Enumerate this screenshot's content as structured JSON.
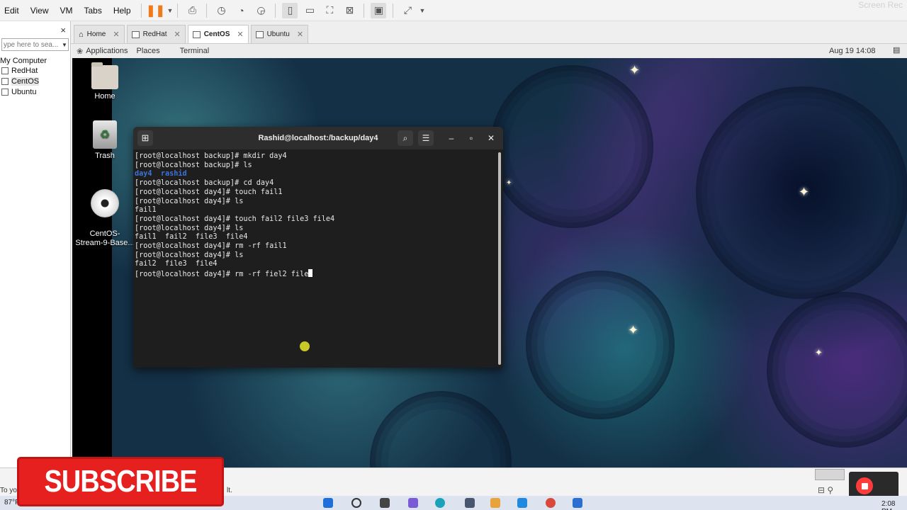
{
  "menubar": {
    "items": [
      "Edit",
      "View",
      "VM",
      "Tabs",
      "Help"
    ],
    "recorder_watermark": "Screen Rec"
  },
  "sidebar": {
    "close_glyph": "×",
    "search_placeholder": "ype here to sea...",
    "root_label": "My Computer",
    "items": [
      {
        "label": "RedHat"
      },
      {
        "label": "CentOS"
      },
      {
        "label": "Ubuntu"
      }
    ]
  },
  "tabs": [
    {
      "label": "Home"
    },
    {
      "label": "RedHat"
    },
    {
      "label": "CentOS"
    },
    {
      "label": "Ubuntu"
    }
  ],
  "gnome": {
    "applications": "Applications",
    "places": "Places",
    "terminal": "Terminal",
    "clock": "Aug 19  14:08"
  },
  "desktop_icons": [
    {
      "label": "Home"
    },
    {
      "label": "Trash"
    },
    {
      "label": "CentOS-\nStream-9-Base..."
    }
  ],
  "terminal": {
    "title": "Rashid@localhost:/backup/day4",
    "lines": [
      "[root@localhost backup]# mkdir day4",
      "[root@localhost backup]# ls",
      "__DIRS__",
      "[root@localhost backup]# cd day4",
      "[root@localhost day4]# touch fail1",
      "[root@localhost day4]# ls",
      "fail1",
      "[root@localhost day4]# touch fail2 file3 file4",
      "[root@localhost day4]# ls",
      "fail1  fail2  file3  file4",
      "[root@localhost day4]# rm -rf fail1",
      "[root@localhost day4]# ls",
      "fail2  file3  file4",
      "[root@localhost day4]# rm -rf fiel2 file"
    ],
    "dir_listing": [
      "day4",
      "rashid"
    ]
  },
  "statusbar": {
    "left_text": "To yo",
    "mid_text": "lt."
  },
  "taskbar": {
    "weather": "87°F",
    "time": "2:08 PM"
  },
  "overlay": {
    "subscribe": "SUBSCRIBE"
  }
}
